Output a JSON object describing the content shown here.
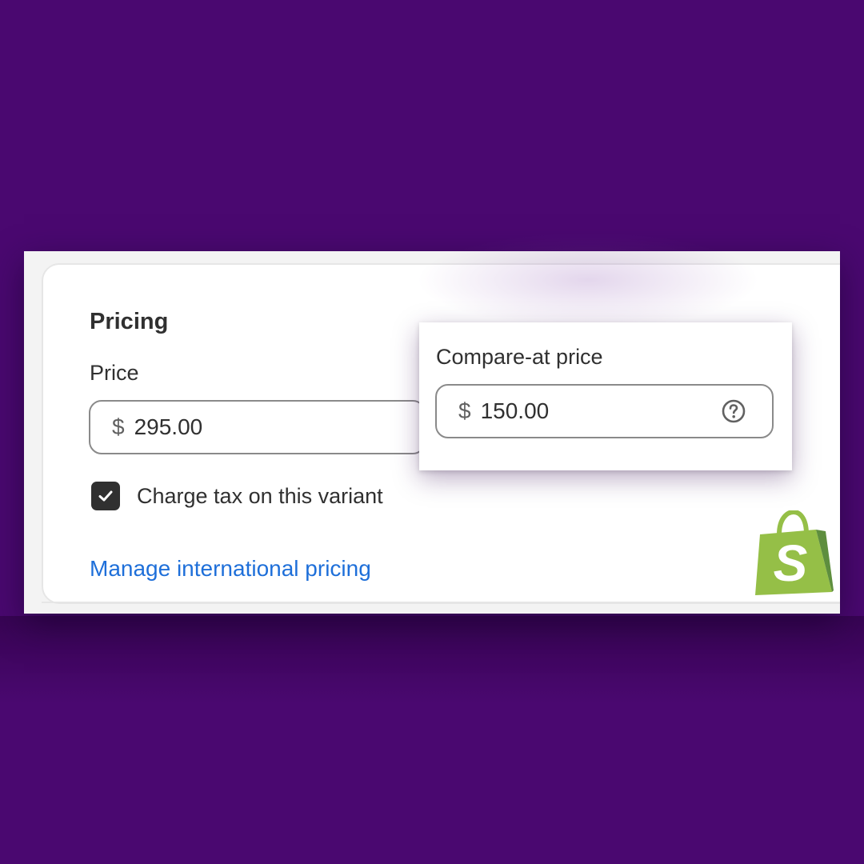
{
  "pricing": {
    "title": "Pricing",
    "price": {
      "label": "Price",
      "currency_symbol": "$",
      "value": "295.00"
    },
    "compare_at": {
      "label": "Compare-at price",
      "currency_symbol": "$",
      "value": "150.00",
      "help_icon": "question-circle-icon"
    },
    "charge_tax": {
      "label": "Charge tax on this variant",
      "checked": true
    },
    "international_link": "Manage international pricing"
  },
  "logo": {
    "icon": "shopify-bag-logo",
    "letter": "S"
  },
  "colors": {
    "background": "#4a0870",
    "link": "#1e6fd9",
    "logo_green": "#95bf47",
    "logo_dark_green": "#5e8e3e"
  }
}
